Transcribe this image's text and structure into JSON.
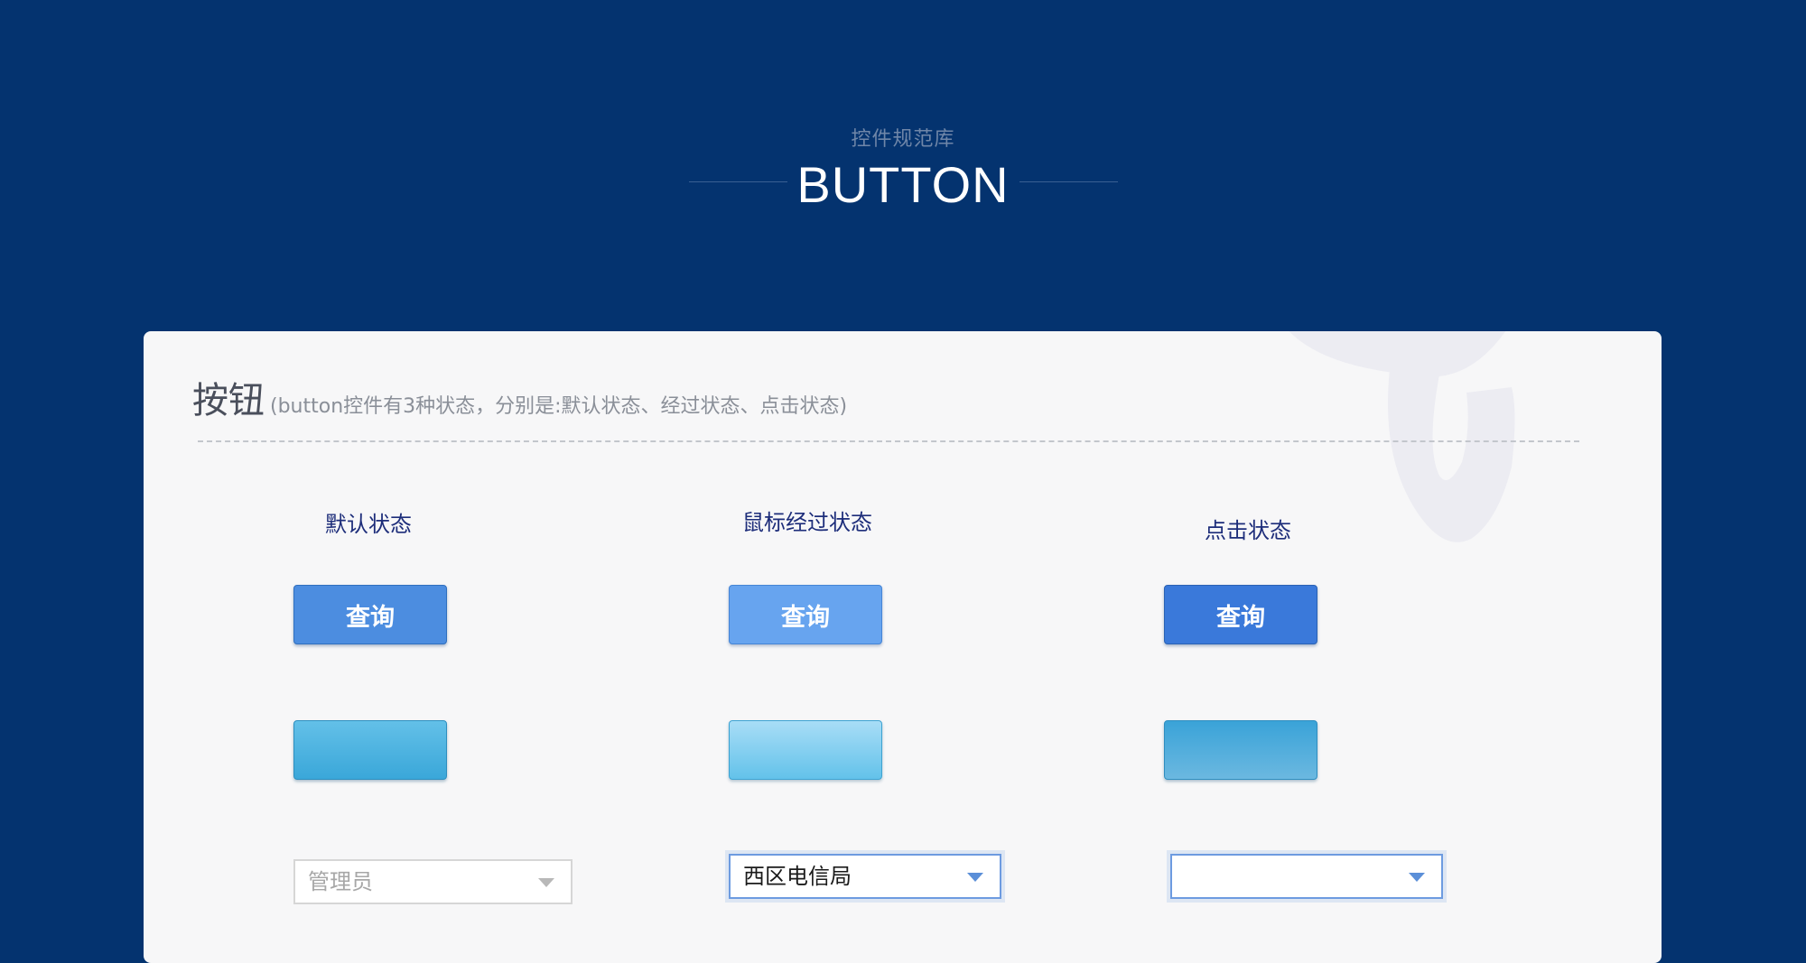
{
  "header": {
    "subtitle": "控件规范库",
    "title": "BUTTON"
  },
  "section": {
    "heading": "按钮",
    "description": "(button控件有3种状态，分别是:默认状态、经过状态、点击状态)"
  },
  "states": {
    "default_label": "默认状态",
    "hover_label": "鼠标经过状态",
    "active_label": "点击状态"
  },
  "buttons": {
    "query_label": "查询"
  },
  "selects": {
    "default_value": "管理员",
    "hover_value": "西区电信局",
    "active_value": ""
  },
  "colors": {
    "page_background": "#04336f",
    "card_background": "#f7f7f8",
    "query_default": "#4c8de0",
    "query_hover": "#67a4ef",
    "query_active": "#3a79da",
    "cyan_default": "#3aa7d9",
    "cyan_hover": "#63c2ea",
    "state_label": "#1d2d7a"
  },
  "icons": {
    "dropdown_caret": "chevron-down-icon",
    "watermark": "telecom-logo"
  }
}
